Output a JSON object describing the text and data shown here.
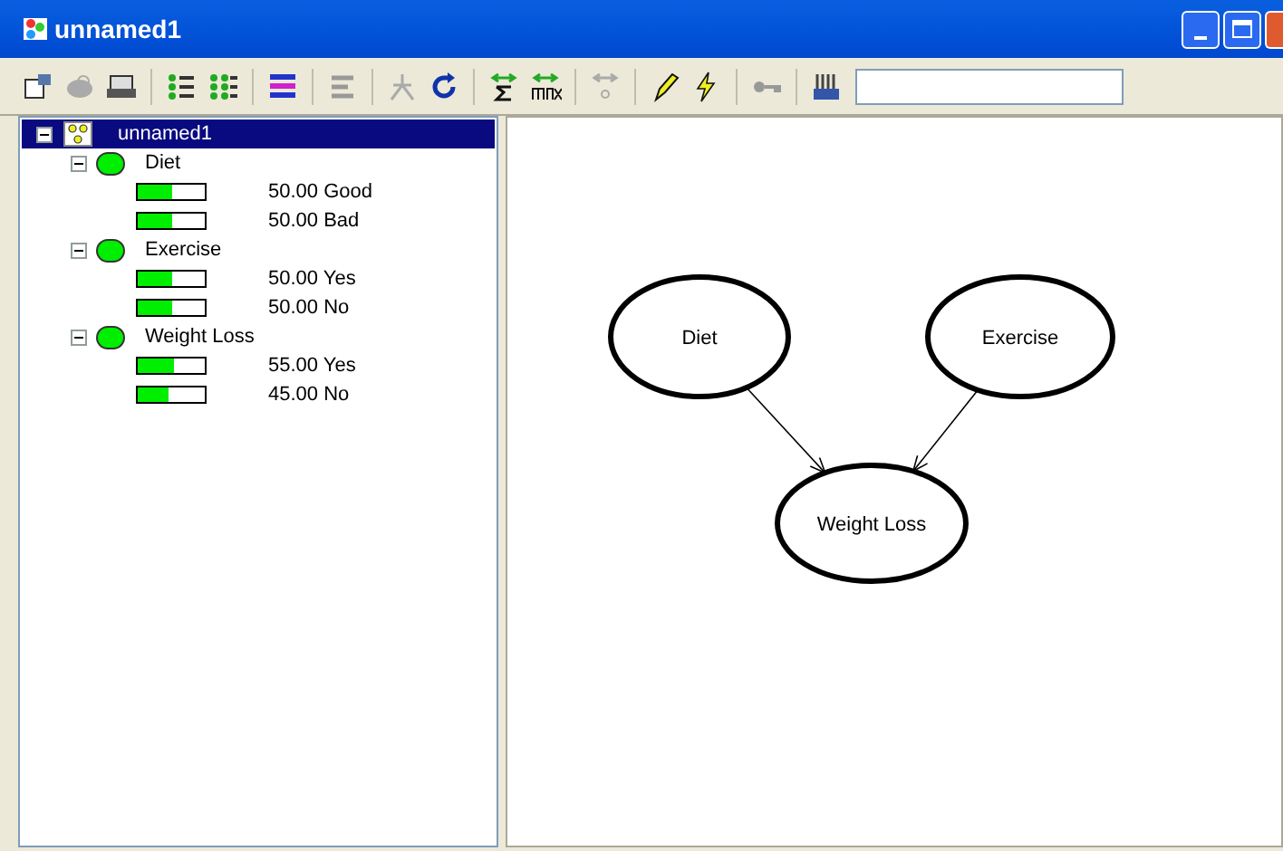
{
  "window": {
    "title": "unnamed1"
  },
  "tree": {
    "root": {
      "label": "unnamed1",
      "selected": true,
      "expanded": true,
      "children": [
        {
          "label": "Diet",
          "expanded": true,
          "states": [
            {
              "probability": "50.00",
              "state": "Good",
              "level": 0.5
            },
            {
              "probability": "50.00",
              "state": "Bad",
              "level": 0.5
            }
          ]
        },
        {
          "label": "Exercise",
          "expanded": true,
          "states": [
            {
              "probability": "50.00",
              "state": "Yes",
              "level": 0.5
            },
            {
              "probability": "50.00",
              "state": "No",
              "level": 0.5
            }
          ]
        },
        {
          "label": "Weight Loss",
          "expanded": true,
          "states": [
            {
              "probability": "55.00",
              "state": "Yes",
              "level": 0.55
            },
            {
              "probability": "45.00",
              "state": "No",
              "level": 0.45
            }
          ]
        }
      ]
    }
  },
  "canvas": {
    "nodes": [
      {
        "label": "Diet"
      },
      {
        "label": "Exercise"
      },
      {
        "label": "Weight Loss"
      }
    ]
  }
}
